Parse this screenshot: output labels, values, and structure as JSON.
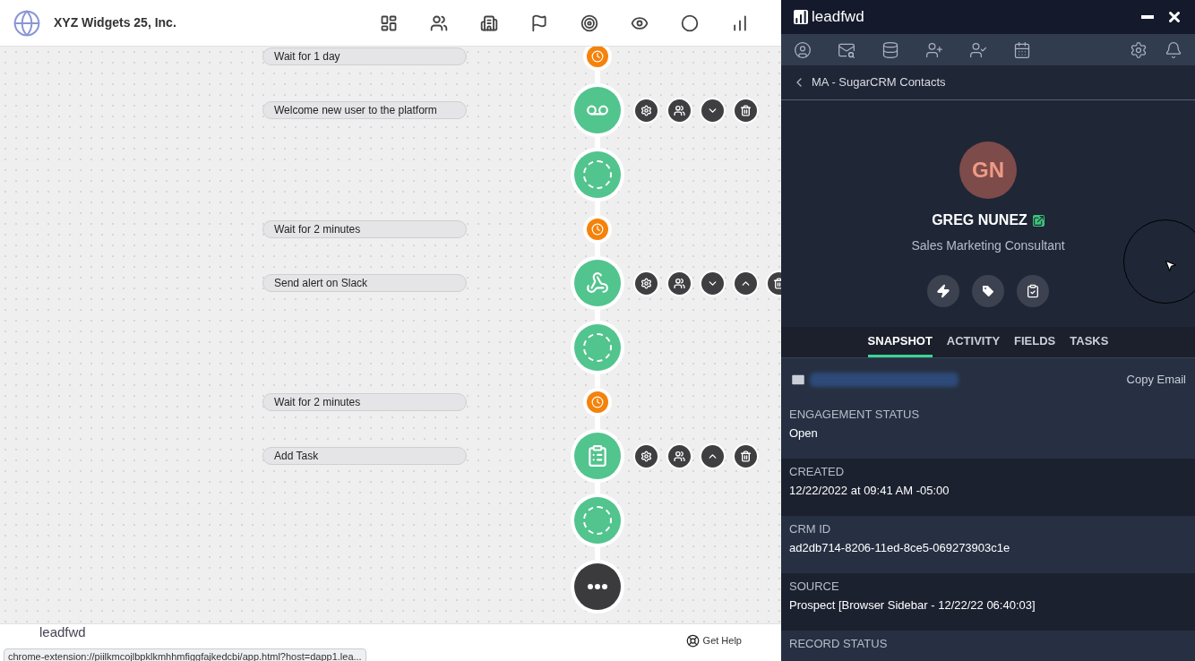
{
  "header": {
    "company": "XYZ Widgets 25, Inc."
  },
  "workflow": [
    {
      "kind": "timer",
      "label": "Wait for 1 day"
    },
    {
      "kind": "message",
      "label": "Welcome new user to the platform",
      "move_up": false,
      "move_down": true
    },
    {
      "kind": "placeholder"
    },
    {
      "kind": "timer",
      "label": "Wait for 2 minutes"
    },
    {
      "kind": "integration",
      "label": "Send alert on Slack",
      "move_up": true,
      "move_down": true
    },
    {
      "kind": "placeholder"
    },
    {
      "kind": "timer",
      "label": "Wait for 2 minutes"
    },
    {
      "kind": "task",
      "label": "Add Task",
      "move_up": true,
      "move_down": false
    },
    {
      "kind": "placeholder"
    },
    {
      "kind": "end"
    }
  ],
  "footer": {
    "logo": "leadfwd",
    "help": "Get Help",
    "status_url": "chrome-extension://piilkmcojlbpklkmhhmfiggfajkedcbi/app.html?host=dapp1.lea..."
  },
  "panel": {
    "title": "leadfwd",
    "breadcrumb": "MA - SugarCRM Contacts",
    "contact": {
      "initials": "GN",
      "name": "GREG NUNEZ",
      "title": "Sales Marketing Consultant"
    },
    "tabs": [
      {
        "label": "SNAPSHOT",
        "selected": true
      },
      {
        "label": "ACTIVITY",
        "selected": false
      },
      {
        "label": "FIELDS",
        "selected": false
      },
      {
        "label": "TASKS",
        "selected": false
      }
    ],
    "copy_email": "Copy Email",
    "fields": [
      {
        "label": "ENGAGEMENT STATUS",
        "value": "Open"
      },
      {
        "label": "CREATED",
        "value": "12/22/2022 at 09:41 AM -05:00"
      },
      {
        "label": "CRM ID",
        "value": "ad2db714-8206-11ed-8ce5-069273903c1e"
      },
      {
        "label": "SOURCE",
        "value": "Prospect [Browser Sidebar - 12/22/22 06:40:03]"
      },
      {
        "label": "RECORD STATUS"
      }
    ]
  }
}
